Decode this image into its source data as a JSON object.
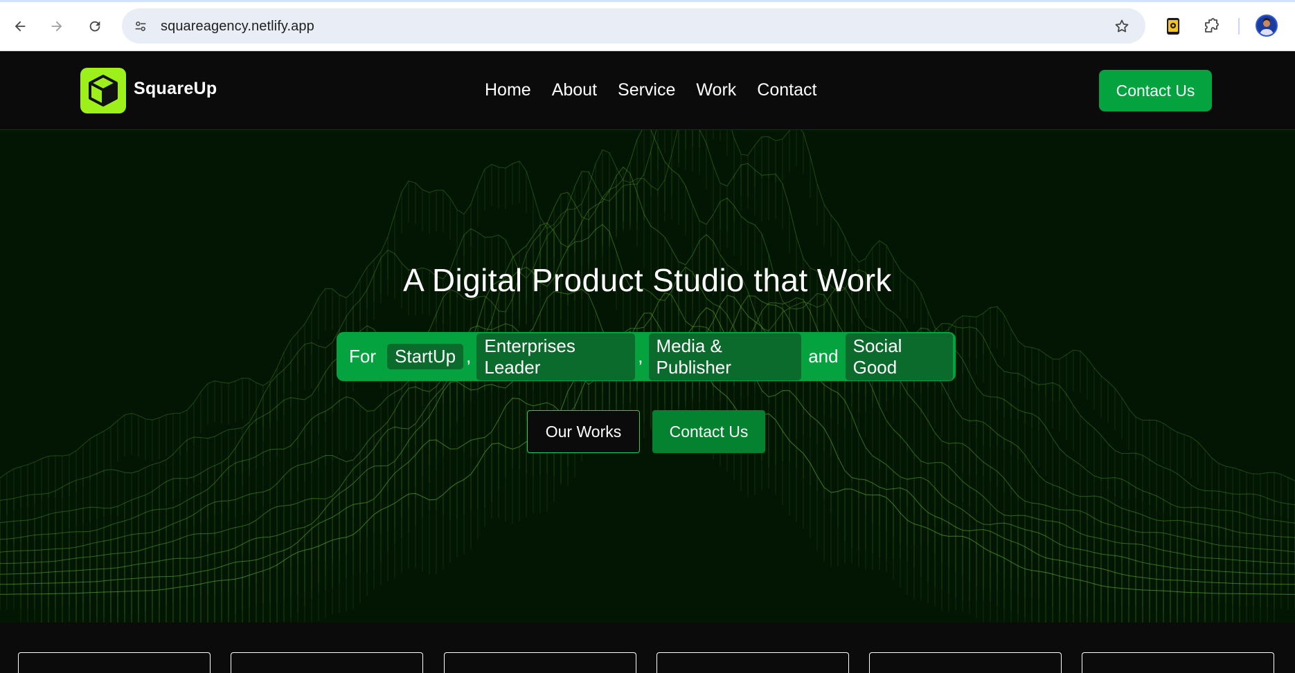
{
  "browser": {
    "url": "squareagency.netlify.app",
    "icons": {
      "back": "arrow-left-icon",
      "forward": "arrow-right-icon",
      "reload": "reload-icon",
      "site_info": "tune-icon",
      "bookmark": "star-icon",
      "extension_app": "phone-extension-icon",
      "extensions": "puzzle-icon",
      "profile": "avatar"
    }
  },
  "site": {
    "brand": "SquareUp",
    "nav": [
      {
        "label": "Home"
      },
      {
        "label": "About"
      },
      {
        "label": "Service"
      },
      {
        "label": "Work"
      },
      {
        "label": "Contact"
      }
    ],
    "nav_cta": "Contact Us",
    "colors": {
      "accent": "#05a33f",
      "logo": "#9ef01a",
      "background": "#0b0b0b",
      "hero_bg": "#031603"
    }
  },
  "hero": {
    "title": "A Digital Product Studio that Work",
    "tagline": {
      "for": "For",
      "items": [
        "StartUp",
        "Enterprises Leader",
        "Media & Publisher"
      ],
      "comma": ",",
      "and": "and",
      "last": "Social Good"
    },
    "buttons": {
      "works": "Our Works",
      "contact": "Contact Us"
    }
  }
}
